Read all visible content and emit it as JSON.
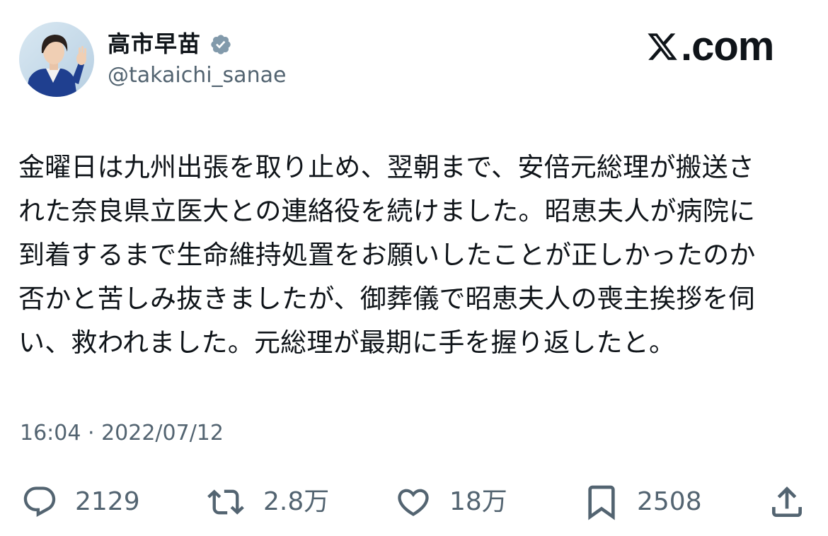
{
  "author": {
    "display_name": "高市早苗",
    "handle": "@takaichi_sanae",
    "verified_icon": "verified-badge-icon"
  },
  "brand": {
    "logo_icon": "x-logo-icon",
    "text": ".com"
  },
  "tweet": {
    "lines": [
      "金曜日は九州出張を取り止め、翌朝まで、安倍元総理が搬送さ",
      "れた奈良県立医大との連絡役を続けました。昭恵夫人が病院に",
      "到着するまで生命維持処置をお願いしたことが正しかったのか",
      "否かと苦しみ抜きましたが、御葬儀で昭恵夫人の喪主挨拶を伺",
      "い、救われました。元総理が最期に手を握り返したと。"
    ]
  },
  "meta": {
    "timestamp": "16:04 · 2022/07/12"
  },
  "actions": {
    "reply": {
      "icon": "reply-icon",
      "count": "2129"
    },
    "retweet": {
      "icon": "retweet-icon",
      "count": "2.8万"
    },
    "like": {
      "icon": "heart-icon",
      "count": "18万"
    },
    "bookmark": {
      "icon": "bookmark-icon",
      "count": "2508"
    },
    "share": {
      "icon": "share-icon"
    }
  },
  "colors": {
    "text_primary": "#0f1419",
    "text_secondary": "#536471",
    "verified": "#829aab",
    "background": "#ffffff"
  }
}
